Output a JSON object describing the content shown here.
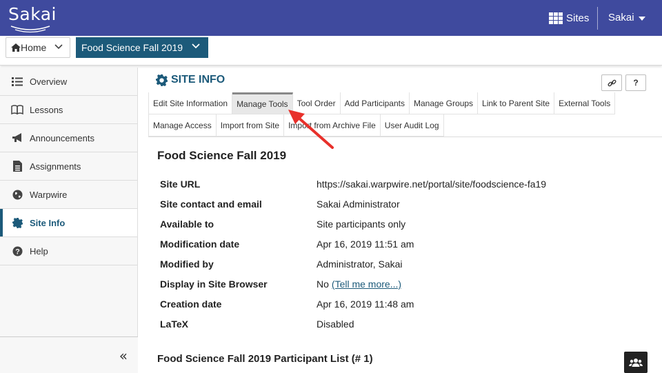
{
  "topbar": {
    "logo_text": "Sakai",
    "sites_label": "Sites",
    "user_label": "Sakai"
  },
  "sitenav": {
    "home_label": "Home",
    "current_site_label": "Food Science Fall 2019"
  },
  "sidebar": {
    "items": [
      {
        "label": "Overview",
        "icon": "list-icon"
      },
      {
        "label": "Lessons",
        "icon": "book-icon"
      },
      {
        "label": "Announcements",
        "icon": "bullhorn-icon"
      },
      {
        "label": "Assignments",
        "icon": "document-icon"
      },
      {
        "label": "Warpwire",
        "icon": "globe-icon"
      },
      {
        "label": "Site Info",
        "icon": "gear-icon"
      },
      {
        "label": "Help",
        "icon": "question-icon"
      }
    ],
    "active": "Site Info",
    "collapse_label": "«"
  },
  "main": {
    "tool_title": "SITE INFO",
    "link_button_icon": "link-icon",
    "help_button_label": "?",
    "tabs_row1": [
      "Edit Site Information",
      "Manage Tools",
      "Tool Order",
      "Add Participants",
      "Manage Groups",
      "Link to Parent Site",
      "External Tools"
    ],
    "tabs_row2": [
      "Manage Access",
      "Import from Site",
      "Import from Archive File",
      "User Audit Log"
    ],
    "selected_tab": "Manage Tools",
    "site_heading": "Food Science Fall 2019",
    "info": [
      {
        "label": "Site URL",
        "value": "https://sakai.warpwire.net/portal/site/foodscience-fa19"
      },
      {
        "label": "Site contact and email",
        "value": "Sakai Administrator"
      },
      {
        "label": "Available to",
        "value": "Site participants only"
      },
      {
        "label": "Modification date",
        "value": "Apr 16, 2019 11:51 am"
      },
      {
        "label": "Modified by",
        "value": "Administrator, Sakai"
      },
      {
        "label": "Display in Site Browser",
        "value": "No",
        "link": "(Tell me more...)"
      },
      {
        "label": "Creation date",
        "value": "Apr 16, 2019 11:48 am"
      },
      {
        "label": "LaTeX",
        "value": "Disabled"
      }
    ],
    "participant_heading": "Food Science Fall 2019 Participant List (# 1)"
  },
  "colors": {
    "topbar": "#3f4a9e",
    "accent": "#1c5a7a",
    "annotation_arrow": "#e8302a"
  }
}
